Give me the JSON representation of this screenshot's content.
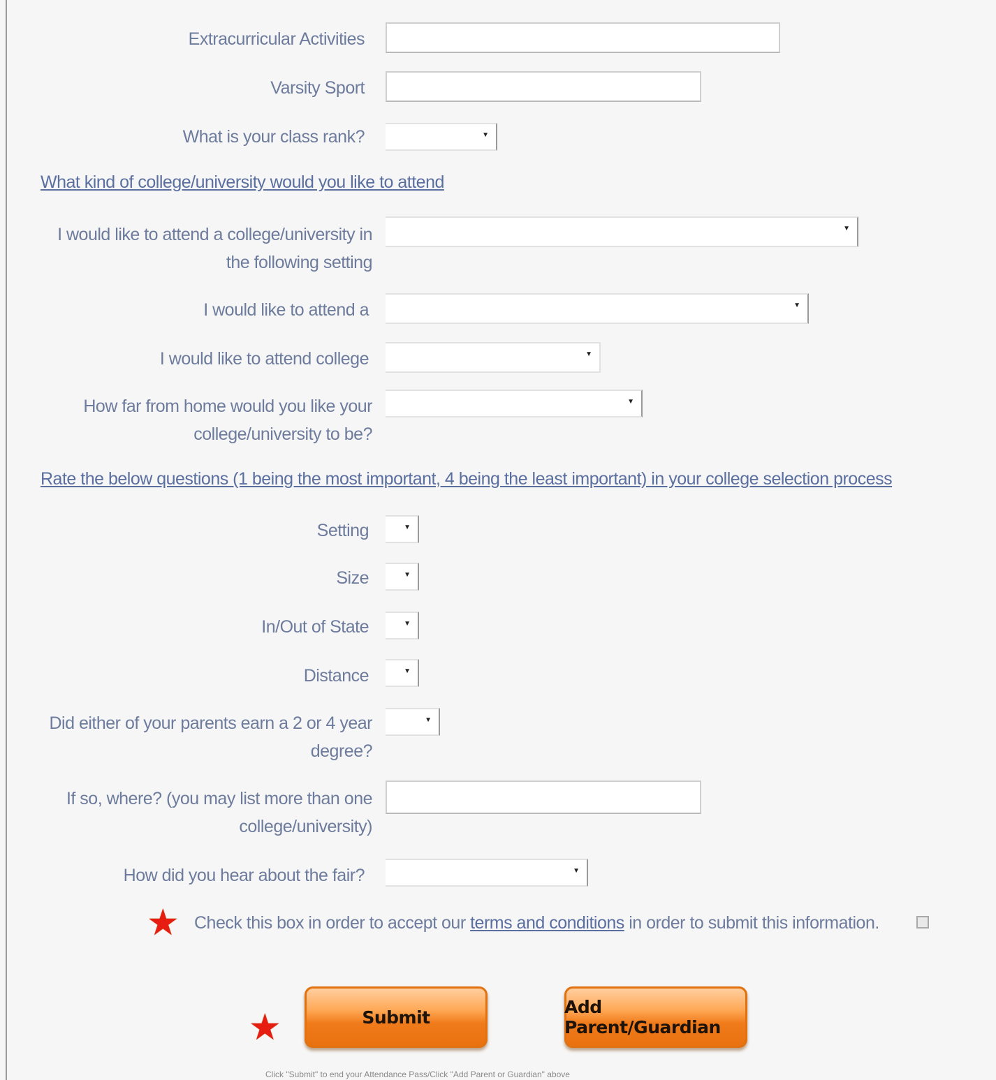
{
  "form": {
    "extracurricular_label": "Extracurricular Activities",
    "varsity_label": "Varsity Sport",
    "class_rank_label": "What is your class rank?",
    "section1_title": "What kind of college/university would you like to attend",
    "setting_label": "I would like to attend a college/university in the following setting",
    "attend_type_label": "I would like to attend a",
    "attend_college_label": "I would like to attend college",
    "distance_label": "How far from home would you like your college/university to be?",
    "section2_title": "Rate the below questions (1 being the most important, 4 being the least important) in your college selection process",
    "rate_setting_label": "Setting",
    "rate_size_label": "Size",
    "rate_state_label": "In/Out of State",
    "rate_distance_label": "Distance",
    "parents_degree_label": "Did either of your parents earn a 2 or 4 year degree?",
    "where_label": "If so, where? (you may list more than one college/university)",
    "hear_label": "How did you hear about the fair?",
    "terms_before": "Check this box in order to accept our ",
    "terms_link": "terms and conditions",
    "terms_after": " in order to submit this information.",
    "submit_label": "Submit",
    "add_parent_label": "Add Parent/Guardian",
    "footer_note": "Click \"Submit\" to end your Attendance Pass/Click \"Add Parent or Guardian\" above"
  },
  "icons": {
    "star": "star-icon",
    "dropdown": "chevron-down-icon"
  },
  "colors": {
    "required_star": "#e81d12",
    "button_orange": "#f07b1a",
    "link": "#5a6fa0",
    "label": "#6d7b9c"
  }
}
